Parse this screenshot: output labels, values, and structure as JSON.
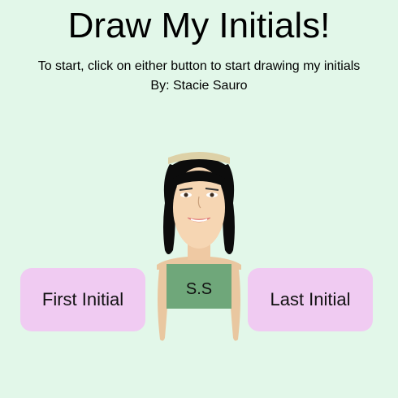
{
  "page": {
    "title": "Draw My Initials!",
    "instructions": "To start, click on either button to start drawing my initials",
    "author": "By: Stacie Sauro"
  },
  "buttons": {
    "first_label": "First Initial",
    "last_label": "Last Initial"
  },
  "figure": {
    "shirt_text": "S.S"
  },
  "colors": {
    "background": "#e2f7e9",
    "button": "#f0cbf2",
    "shirt": "#6fa77a",
    "skin": "#f6d6b3",
    "hair": "#0c0c0c",
    "headband": "#ddd1a7"
  }
}
